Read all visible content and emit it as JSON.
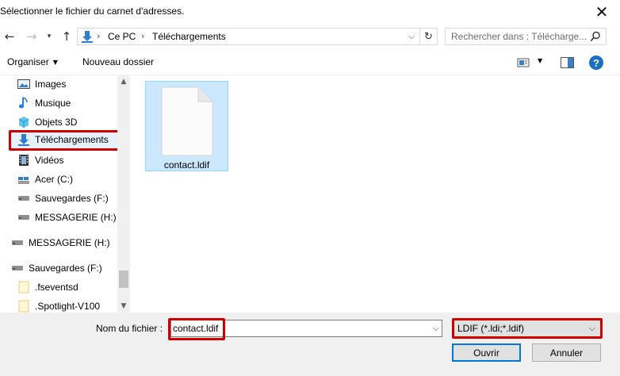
{
  "window": {
    "title": "Sélectionner le fichier du carnet d'adresses.",
    "close_glyph": "✕"
  },
  "nav": {
    "back_glyph": "←",
    "forward_glyph": "→",
    "recent_glyph": "▾",
    "up_glyph": "↑"
  },
  "address": {
    "crumbs": [
      "Ce PC",
      "Téléchargements"
    ],
    "separator": "›",
    "dropdown_glyph": "⌵",
    "refresh_glyph": "↻"
  },
  "search": {
    "placeholder": "Rechercher dans : Télécharge..."
  },
  "toolbar": {
    "organize_label": "Organiser",
    "organize_caret": "▼",
    "new_folder_label": "Nouveau dossier",
    "view_caret": "▼",
    "help_label": "?"
  },
  "sidebar": {
    "items": [
      {
        "label": "Images",
        "icon": "images-icon"
      },
      {
        "label": "Musique",
        "icon": "music-icon"
      },
      {
        "label": "Objets 3D",
        "icon": "objects-3d-icon"
      },
      {
        "label": "Téléchargements",
        "icon": "downloads-icon",
        "selected": true
      },
      {
        "label": "Vidéos",
        "icon": "videos-icon"
      },
      {
        "label": "Acer (C:)",
        "icon": "drive-icon"
      },
      {
        "label": "Sauvegardes (F:)",
        "icon": "drive-icon"
      },
      {
        "label": "MESSAGERIE (H:)",
        "icon": "drive-icon"
      },
      {
        "label": "MESSAGERIE (H:)",
        "icon": "drive-icon"
      },
      {
        "label": "Sauvegardes (F:)",
        "icon": "drive-icon"
      },
      {
        "label": ".fseventsd",
        "icon": "folder-icon"
      },
      {
        "label": ".Spotlight-V100",
        "icon": "folder-icon"
      }
    ],
    "scroll_up_glyph": "▲",
    "scroll_down_glyph": "▼"
  },
  "files": [
    {
      "name": "contact.ldif",
      "selected": true
    }
  ],
  "bottom": {
    "filename_label": "Nom du fichier :",
    "filename_value": "contact.ldif",
    "filename_dropdown_glyph": "⌵",
    "filetype_value": "LDIF (*.ldi;*.ldif)",
    "filetype_dropdown_glyph": "⌵",
    "open_label": "Ouvrir",
    "cancel_label": "Annuler"
  },
  "colors": {
    "highlight_red": "#d00000",
    "selection_blue": "#cce8ff",
    "accent": "#0078d7"
  }
}
